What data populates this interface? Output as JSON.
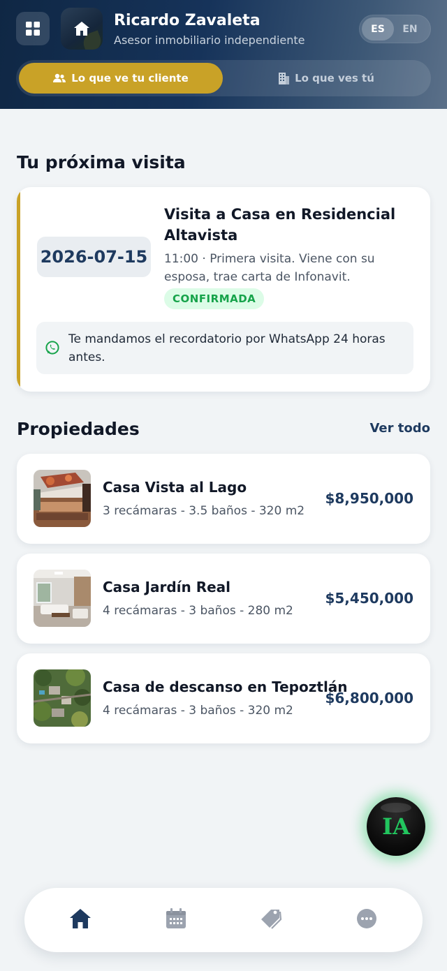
{
  "header": {
    "agent_name": "Ricardo Zavaleta",
    "agent_role": "Asesor inmobiliario independiente",
    "lang_es": "ES",
    "lang_en": "EN",
    "view_client": "Lo que ve tu cliente",
    "view_agent": "Lo que ves tú",
    "colors": {
      "accent": "#c9a227",
      "navy": "#0f2744"
    }
  },
  "next_visit": {
    "section_title": "Tu próxima visita",
    "date": "2026-07-15",
    "title": "Visita a Casa en Residencial Altavista",
    "description": "11:00 · Primera visita. Viene con su esposa, trae carta de Infonavit.",
    "status": "CONFIRMADA",
    "reminder": "Te mandamos el recordatorio por WhatsApp 24 horas antes."
  },
  "properties": {
    "section_title": "Propiedades",
    "see_all": "Ver todo",
    "items": [
      {
        "name": "Casa Vista al Lago",
        "specs": "3 recámaras - 3.5 baños - 320 m2",
        "price": "$8,950,000"
      },
      {
        "name": "Casa Jardín Real",
        "specs": "4 recámaras - 3 baños - 280 m2",
        "price": "$5,450,000"
      },
      {
        "name": "Casa de descanso en Tepoztlán",
        "specs": "4 recámaras - 3 baños - 320 m2",
        "price": "$6,800,000"
      }
    ]
  },
  "ai_button": {
    "label": "IA"
  },
  "bottom_nav": {
    "items": [
      {
        "icon": "home-icon",
        "active": true
      },
      {
        "icon": "calendar-icon",
        "active": false
      },
      {
        "icon": "tag-icon",
        "active": false
      },
      {
        "icon": "more-icon",
        "active": false
      }
    ]
  }
}
